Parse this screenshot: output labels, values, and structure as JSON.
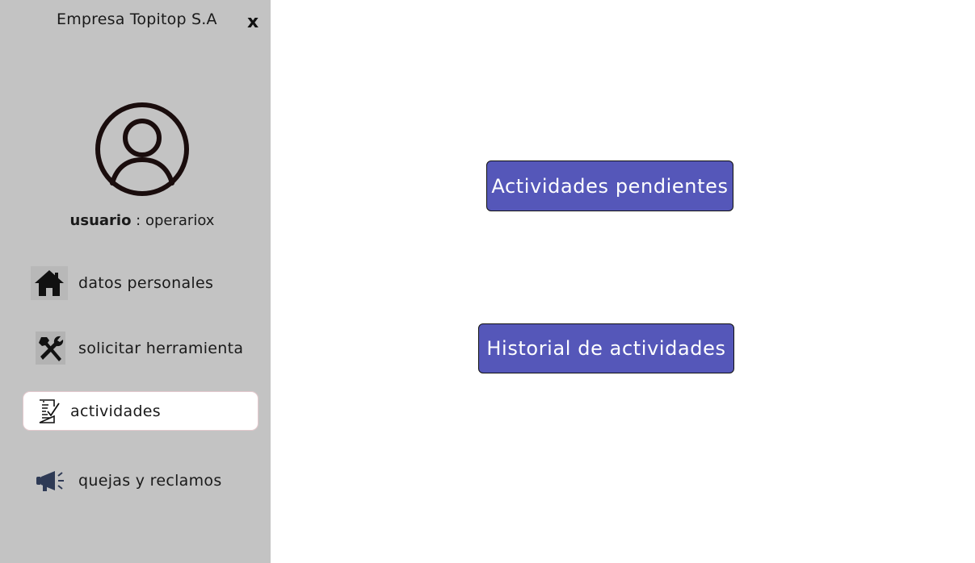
{
  "sidebar": {
    "company_name": "Empresa Topitop S.A",
    "close_label": "x",
    "user": {
      "label": "usuario",
      "separator": " : ",
      "value": "operariox"
    },
    "items": [
      {
        "label": "datos personales",
        "icon": "home-icon"
      },
      {
        "label": "solicitar herramienta",
        "icon": "tools-icon"
      },
      {
        "label": "actividades",
        "icon": "task-checklist-icon",
        "active": true
      },
      {
        "label": "quejas y reclamos",
        "icon": "megaphone-icon"
      }
    ]
  },
  "main": {
    "pending_button": "Actividades pendientes",
    "history_button": "Historial de actividades"
  },
  "colors": {
    "sidebar_bg": "#c3c3c3",
    "button_bg": "#5557b9",
    "button_text": "#ffffff",
    "active_item_bg": "#ffffff"
  }
}
